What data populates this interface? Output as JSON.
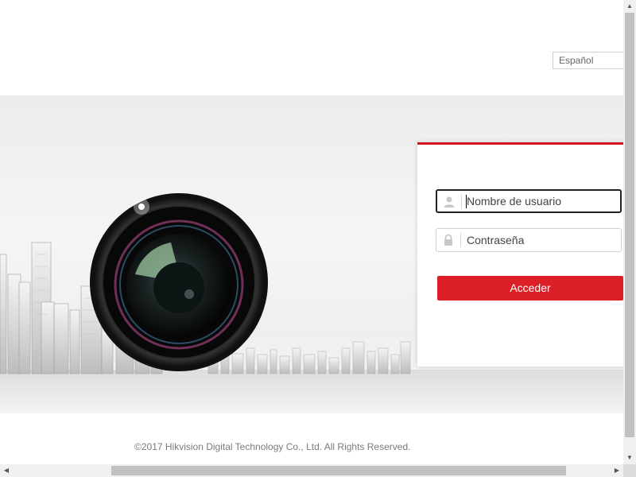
{
  "language": {
    "selected": "Español"
  },
  "login": {
    "username_placeholder": "Nombre de usuario",
    "password_placeholder": "Contraseña",
    "submit_label": "Acceder"
  },
  "footer": {
    "copyright": "©2017 Hikvision Digital Technology Co., Ltd. All Rights Reserved."
  },
  "icons": {
    "user": "user-icon",
    "lock": "lock-icon"
  },
  "colors": {
    "accent": "#da1f26",
    "card_top_border": "#d7151f"
  }
}
